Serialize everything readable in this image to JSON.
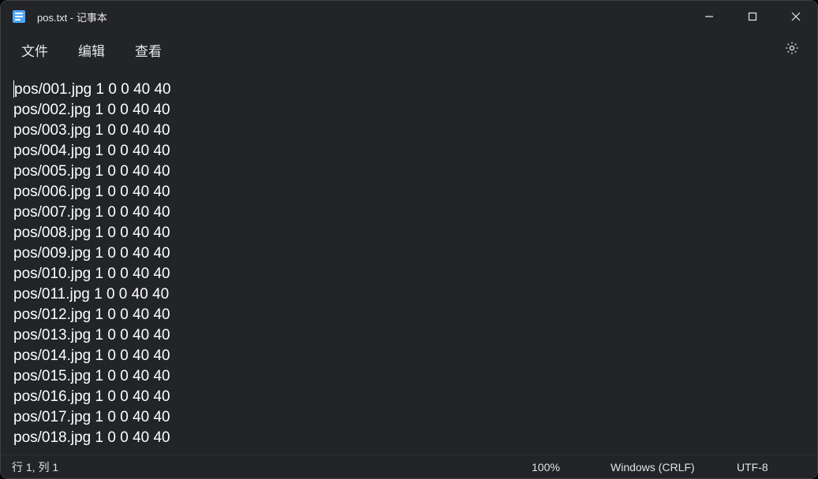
{
  "titlebar": {
    "title": "pos.txt - 记事本"
  },
  "menu": {
    "file": "文件",
    "edit": "编辑",
    "view": "查看"
  },
  "content": {
    "lines": [
      "pos/001.jpg 1 0 0 40 40",
      "pos/002.jpg 1 0 0 40 40",
      "pos/003.jpg 1 0 0 40 40",
      "pos/004.jpg 1 0 0 40 40",
      "pos/005.jpg 1 0 0 40 40",
      "pos/006.jpg 1 0 0 40 40",
      "pos/007.jpg 1 0 0 40 40",
      "pos/008.jpg 1 0 0 40 40",
      "pos/009.jpg 1 0 0 40 40",
      "pos/010.jpg 1 0 0 40 40",
      "pos/011.jpg 1 0 0 40 40",
      "pos/012.jpg 1 0 0 40 40",
      "pos/013.jpg 1 0 0 40 40",
      "pos/014.jpg 1 0 0 40 40",
      "pos/015.jpg 1 0 0 40 40",
      "pos/016.jpg 1 0 0 40 40",
      "pos/017.jpg 1 0 0 40 40",
      "pos/018.jpg 1 0 0 40 40"
    ]
  },
  "status": {
    "position": "行 1, 列 1",
    "zoom": "100%",
    "eol": "Windows (CRLF)",
    "encoding": "UTF-8"
  }
}
